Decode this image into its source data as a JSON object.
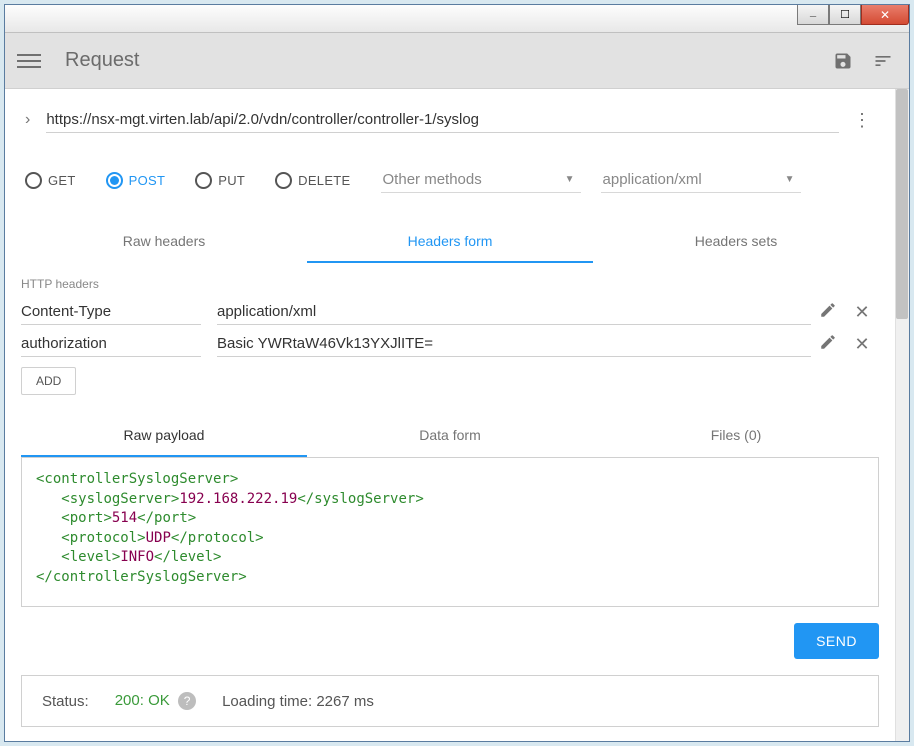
{
  "titlebar": {},
  "toolbar": {
    "title": "Request"
  },
  "url": "https://nsx-mgt.virten.lab/api/2.0/vdn/controller/controller-1/syslog",
  "methods": {
    "get_label": "GET",
    "post_label": "POST",
    "put_label": "PUT",
    "delete_label": "DELETE",
    "other_label": "Other methods",
    "content_type": "application/xml",
    "selected": "POST"
  },
  "header_tabs": {
    "raw": "Raw headers",
    "form": "Headers form",
    "sets": "Headers sets"
  },
  "section_label": "HTTP headers",
  "headers": [
    {
      "name": "Content-Type",
      "value": "application/xml"
    },
    {
      "name": "authorization",
      "value": "Basic YWRtaW46Vk13YXJlITE="
    }
  ],
  "add_label": "ADD",
  "payload_tabs": {
    "raw": "Raw payload",
    "data": "Data form",
    "files": "Files (0)"
  },
  "payload": {
    "root_open": "<controllerSyslogServer>",
    "syslog_open": "<syslogServer>",
    "syslog_val": "192.168.222.19",
    "syslog_close": "</syslogServer>",
    "port_open": "<port>",
    "port_val": "514",
    "port_close": "</port>",
    "protocol_open": "<protocol>",
    "protocol_val": "UDP",
    "protocol_close": "</protocol>",
    "level_open": "<level>",
    "level_val": "INFO",
    "level_close": "</level>",
    "root_close": "</controllerSyslogServer>"
  },
  "send_label": "SEND",
  "status": {
    "label": "Status:",
    "code": "200: OK",
    "loading": "Loading time: 2267 ms"
  }
}
